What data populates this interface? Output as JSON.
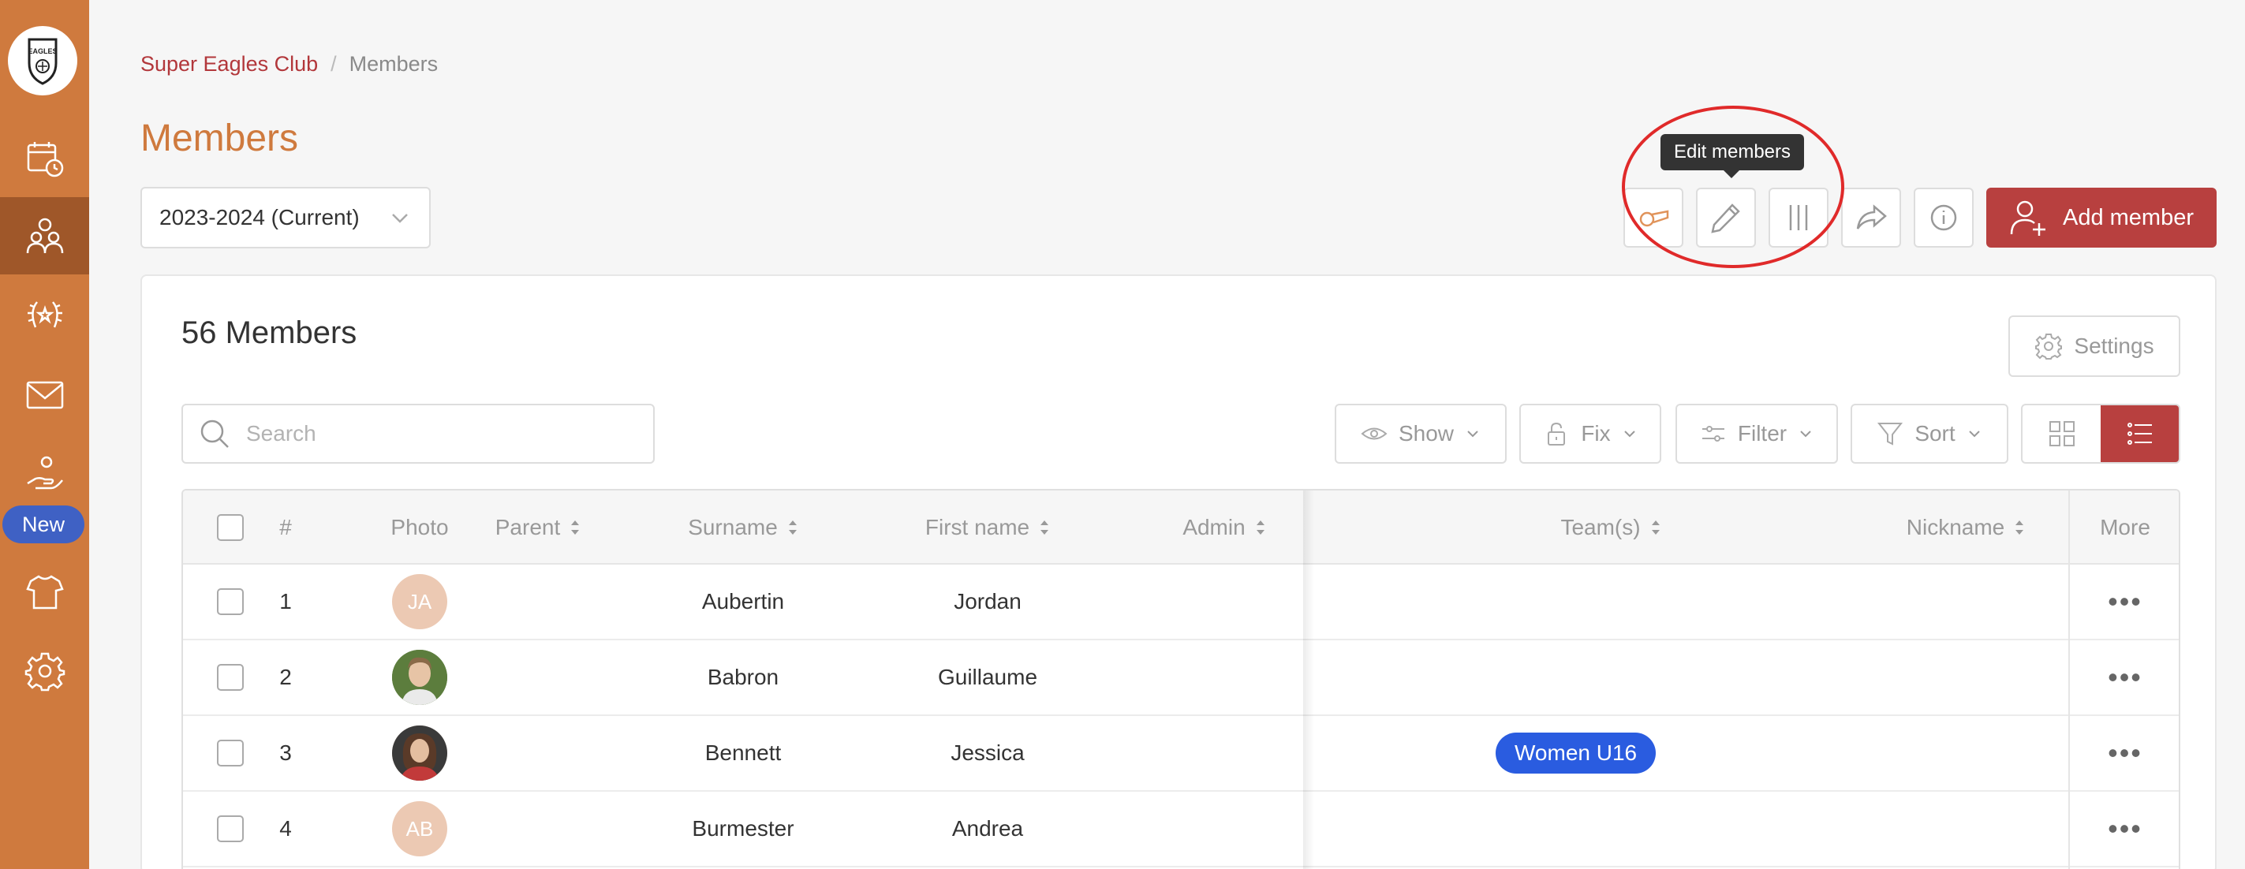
{
  "breadcrumb": {
    "club": "Super Eagles Club",
    "separator": "/",
    "current": "Members"
  },
  "page_title": "Members",
  "season": {
    "selected": "2023-2024 (Current)"
  },
  "sidebar": {
    "new_badge": "New",
    "logo_text": "EAGLES"
  },
  "tooltip": "Edit members",
  "add_member_label": "Add member",
  "card": {
    "count_title": "56 Members",
    "settings_label": "Settings",
    "search_placeholder": "Search",
    "show_label": "Show",
    "fix_label": "Fix",
    "filter_label": "Filter",
    "sort_label": "Sort"
  },
  "table": {
    "headers": {
      "num": "#",
      "photo": "Photo",
      "parent": "Parent",
      "surname": "Surname",
      "firstname": "First name",
      "admin": "Admin",
      "teams": "Team(s)",
      "nickname": "Nickname",
      "more": "More"
    },
    "rows": [
      {
        "num": "1",
        "initials": "JA",
        "surname": "Aubertin",
        "firstname": "Jordan",
        "team": ""
      },
      {
        "num": "2",
        "initials": "",
        "surname": "Babron",
        "firstname": "Guillaume",
        "team": ""
      },
      {
        "num": "3",
        "initials": "",
        "surname": "Bennett",
        "firstname": "Jessica",
        "team": "Women U16"
      },
      {
        "num": "4",
        "initials": "AB",
        "surname": "Burmester",
        "firstname": "Andrea",
        "team": ""
      }
    ],
    "more_dots": "•••"
  },
  "colors": {
    "sidebar": "#cf7a3e",
    "sidebar_active": "#9f5729",
    "accent_red": "#b8403f",
    "badge_blue": "#2a5ce0",
    "new_badge": "#3f61c4"
  }
}
